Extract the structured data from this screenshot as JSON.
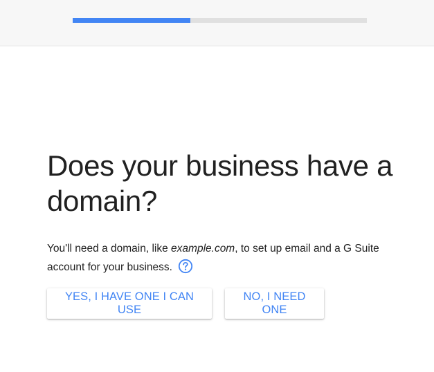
{
  "progress": {
    "fraction": 0.4
  },
  "question": {
    "title": "Does your business have a domain?"
  },
  "description": {
    "before": "You'll need a domain, like ",
    "example": "example.com",
    "after": ", to set up email and a G Suite account for your business."
  },
  "help": {
    "icon": "help-circle-icon"
  },
  "buttons": {
    "yes_label": "YES, I HAVE ONE I CAN USE",
    "no_label": "NO, I NEED ONE"
  },
  "colors": {
    "accent": "#4285f4",
    "text": "#212121",
    "track": "#e0e0e0"
  }
}
